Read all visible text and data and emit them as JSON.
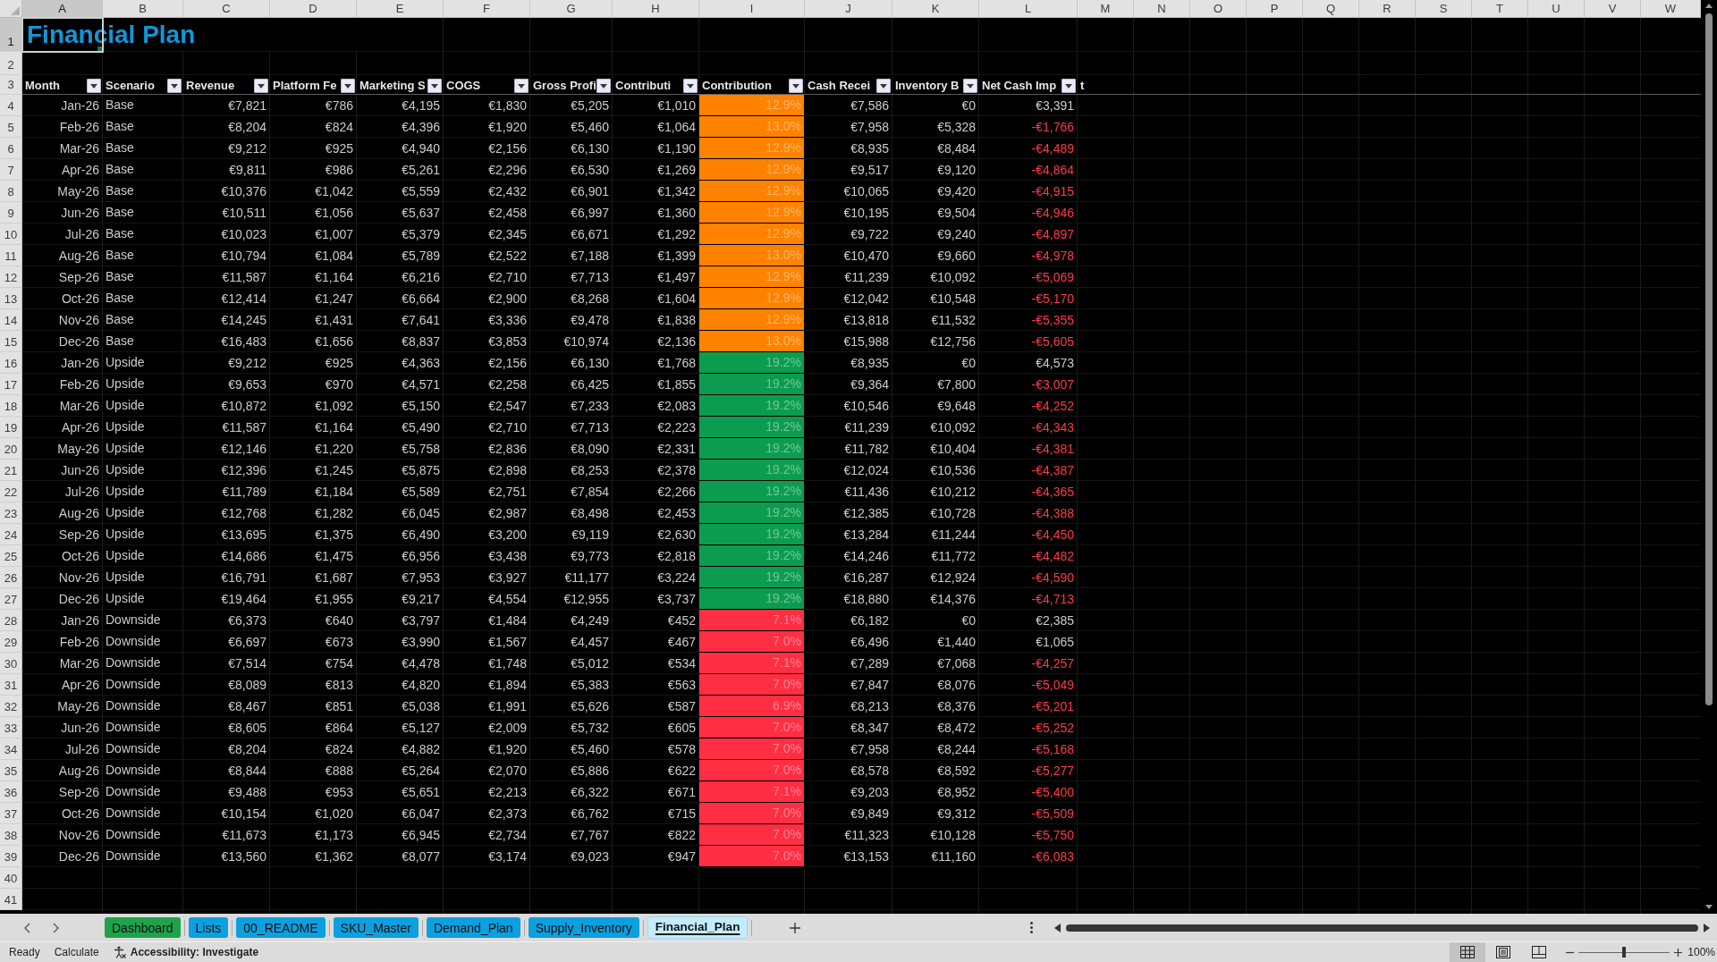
{
  "sheet": {
    "columns": [
      {
        "letter": "A",
        "selected": true
      },
      {
        "letter": "B",
        "selected": false
      },
      {
        "letter": "C",
        "selected": false
      },
      {
        "letter": "D",
        "selected": false
      },
      {
        "letter": "E",
        "selected": false
      },
      {
        "letter": "F",
        "selected": false
      },
      {
        "letter": "G",
        "selected": false
      },
      {
        "letter": "H",
        "selected": false
      },
      {
        "letter": "I",
        "selected": false
      },
      {
        "letter": "J",
        "selected": false
      },
      {
        "letter": "K",
        "selected": false
      },
      {
        "letter": "L",
        "selected": false
      },
      {
        "letter": "M",
        "selected": false
      },
      {
        "letter": "N",
        "selected": false
      },
      {
        "letter": "O",
        "selected": false
      },
      {
        "letter": "P",
        "selected": false
      },
      {
        "letter": "Q",
        "selected": false
      },
      {
        "letter": "R",
        "selected": false
      },
      {
        "letter": "S",
        "selected": false
      },
      {
        "letter": "T",
        "selected": false
      },
      {
        "letter": "U",
        "selected": false
      },
      {
        "letter": "V",
        "selected": false
      },
      {
        "letter": "W",
        "selected": false
      }
    ],
    "rows": [
      {
        "label": "1",
        "selected": true
      },
      {
        "label": "2",
        "selected": false
      },
      {
        "label": "3",
        "selected": false
      },
      {
        "label": "4",
        "selected": false
      },
      {
        "label": "5",
        "selected": false
      },
      {
        "label": "6",
        "selected": false
      },
      {
        "label": "7",
        "selected": false
      },
      {
        "label": "8",
        "selected": false
      },
      {
        "label": "9",
        "selected": false
      },
      {
        "label": "10",
        "selected": false
      },
      {
        "label": "11",
        "selected": false
      },
      {
        "label": "12",
        "selected": false
      },
      {
        "label": "13",
        "selected": false
      },
      {
        "label": "14",
        "selected": false
      },
      {
        "label": "15",
        "selected": false
      },
      {
        "label": "16",
        "selected": false
      },
      {
        "label": "17",
        "selected": false
      },
      {
        "label": "18",
        "selected": false
      },
      {
        "label": "19",
        "selected": false
      },
      {
        "label": "20",
        "selected": false
      },
      {
        "label": "21",
        "selected": false
      },
      {
        "label": "22",
        "selected": false
      },
      {
        "label": "23",
        "selected": false
      },
      {
        "label": "24",
        "selected": false
      },
      {
        "label": "25",
        "selected": false
      },
      {
        "label": "26",
        "selected": false
      },
      {
        "label": "27",
        "selected": false
      },
      {
        "label": "28",
        "selected": false
      },
      {
        "label": "29",
        "selected": false
      },
      {
        "label": "30",
        "selected": false
      },
      {
        "label": "31",
        "selected": false
      },
      {
        "label": "32",
        "selected": false
      },
      {
        "label": "33",
        "selected": false
      },
      {
        "label": "34",
        "selected": false
      },
      {
        "label": "35",
        "selected": false
      },
      {
        "label": "36",
        "selected": false
      },
      {
        "label": "37",
        "selected": false
      },
      {
        "label": "38",
        "selected": false
      },
      {
        "label": "39",
        "selected": false
      },
      {
        "label": "40",
        "selected": false
      },
      {
        "label": "41",
        "selected": false
      }
    ],
    "title": "Financial Plan"
  },
  "table": {
    "columns": [
      {
        "label": "Month",
        "kind": "date"
      },
      {
        "label": "Scenario",
        "kind": "text"
      },
      {
        "label": "Revenue",
        "kind": "currency"
      },
      {
        "label": "Platform Fe",
        "kind": "currency"
      },
      {
        "label": "Marketing S",
        "kind": "currency"
      },
      {
        "label": "COGS",
        "kind": "currency"
      },
      {
        "label": "Gross Profi",
        "kind": "currency"
      },
      {
        "label": "Contributi",
        "kind": "currency"
      },
      {
        "label": "Contribution",
        "kind": "percent"
      },
      {
        "label": "Cash Recei",
        "kind": "currency"
      },
      {
        "label": "Inventory B",
        "kind": "currency"
      },
      {
        "label": "Net Cash Imp",
        "tail": "t",
        "kind": "signed_currency"
      }
    ],
    "rows": [
      {
        "cells": [
          "Jan-26",
          "Base",
          "€7,821",
          "€786",
          "€4,195",
          "€1,830",
          "€5,205",
          "€1,010",
          "12.9%",
          "€7,586",
          "€0",
          "€3,391"
        ],
        "color": "#ff8200",
        "negative": false
      },
      {
        "cells": [
          "Feb-26",
          "Base",
          "€8,204",
          "€824",
          "€4,396",
          "€1,920",
          "€5,460",
          "€1,064",
          "13.0%",
          "€7,958",
          "€5,328",
          "-€1,766"
        ],
        "color": "#ff8200",
        "negative": true
      },
      {
        "cells": [
          "Mar-26",
          "Base",
          "€9,212",
          "€925",
          "€4,940",
          "€2,156",
          "€6,130",
          "€1,190",
          "12.9%",
          "€8,935",
          "€8,484",
          "-€4,489"
        ],
        "color": "#ff8200",
        "negative": true
      },
      {
        "cells": [
          "Apr-26",
          "Base",
          "€9,811",
          "€986",
          "€5,261",
          "€2,296",
          "€6,530",
          "€1,269",
          "12.9%",
          "€9,517",
          "€9,120",
          "-€4,864"
        ],
        "color": "#ff8200",
        "negative": true
      },
      {
        "cells": [
          "May-26",
          "Base",
          "€10,376",
          "€1,042",
          "€5,559",
          "€2,432",
          "€6,901",
          "€1,342",
          "12.9%",
          "€10,065",
          "€9,420",
          "-€4,915"
        ],
        "color": "#ff8200",
        "negative": true
      },
      {
        "cells": [
          "Jun-26",
          "Base",
          "€10,511",
          "€1,056",
          "€5,637",
          "€2,458",
          "€6,997",
          "€1,360",
          "12.9%",
          "€10,195",
          "€9,504",
          "-€4,946"
        ],
        "color": "#ff8200",
        "negative": true
      },
      {
        "cells": [
          "Jul-26",
          "Base",
          "€10,023",
          "€1,007",
          "€5,379",
          "€2,345",
          "€6,671",
          "€1,292",
          "12.9%",
          "€9,722",
          "€9,240",
          "-€4,897"
        ],
        "color": "#ff8200",
        "negative": true
      },
      {
        "cells": [
          "Aug-26",
          "Base",
          "€10,794",
          "€1,084",
          "€5,789",
          "€2,522",
          "€7,188",
          "€1,399",
          "13.0%",
          "€10,470",
          "€9,660",
          "-€4,978"
        ],
        "color": "#ff8200",
        "negative": true
      },
      {
        "cells": [
          "Sep-26",
          "Base",
          "€11,587",
          "€1,164",
          "€6,216",
          "€2,710",
          "€7,713",
          "€1,497",
          "12.9%",
          "€11,239",
          "€10,092",
          "-€5,069"
        ],
        "color": "#ff8200",
        "negative": true
      },
      {
        "cells": [
          "Oct-26",
          "Base",
          "€12,414",
          "€1,247",
          "€6,664",
          "€2,900",
          "€8,268",
          "€1,604",
          "12.9%",
          "€12,042",
          "€10,548",
          "-€5,170"
        ],
        "color": "#ff8200",
        "negative": true
      },
      {
        "cells": [
          "Nov-26",
          "Base",
          "€14,245",
          "€1,431",
          "€7,641",
          "€3,336",
          "€9,478",
          "€1,838",
          "12.9%",
          "€13,818",
          "€11,532",
          "-€5,355"
        ],
        "color": "#ff8200",
        "negative": true
      },
      {
        "cells": [
          "Dec-26",
          "Base",
          "€16,483",
          "€1,656",
          "€8,837",
          "€3,853",
          "€10,974",
          "€2,136",
          "13.0%",
          "€15,988",
          "€12,756",
          "-€5,605"
        ],
        "color": "#ff8200",
        "negative": true
      },
      {
        "cells": [
          "Jan-26",
          "Upside",
          "€9,212",
          "€925",
          "€4,363",
          "€2,156",
          "€6,130",
          "€1,768",
          "19.2%",
          "€8,935",
          "€0",
          "€4,573"
        ],
        "color": "#0c9c50",
        "negative": false
      },
      {
        "cells": [
          "Feb-26",
          "Upside",
          "€9,653",
          "€970",
          "€4,571",
          "€2,258",
          "€6,425",
          "€1,855",
          "19.2%",
          "€9,364",
          "€7,800",
          "-€3,007"
        ],
        "color": "#0c9c50",
        "negative": true
      },
      {
        "cells": [
          "Mar-26",
          "Upside",
          "€10,872",
          "€1,092",
          "€5,150",
          "€2,547",
          "€7,233",
          "€2,083",
          "19.2%",
          "€10,546",
          "€9,648",
          "-€4,252"
        ],
        "color": "#0c9c50",
        "negative": true
      },
      {
        "cells": [
          "Apr-26",
          "Upside",
          "€11,587",
          "€1,164",
          "€5,490",
          "€2,710",
          "€7,713",
          "€2,223",
          "19.2%",
          "€11,239",
          "€10,092",
          "-€4,343"
        ],
        "color": "#0c9c50",
        "negative": true
      },
      {
        "cells": [
          "May-26",
          "Upside",
          "€12,146",
          "€1,220",
          "€5,758",
          "€2,836",
          "€8,090",
          "€2,331",
          "19.2%",
          "€11,782",
          "€10,404",
          "-€4,381"
        ],
        "color": "#0c9c50",
        "negative": true
      },
      {
        "cells": [
          "Jun-26",
          "Upside",
          "€12,396",
          "€1,245",
          "€5,875",
          "€2,898",
          "€8,253",
          "€2,378",
          "19.2%",
          "€12,024",
          "€10,536",
          "-€4,387"
        ],
        "color": "#0c9c50",
        "negative": true
      },
      {
        "cells": [
          "Jul-26",
          "Upside",
          "€11,789",
          "€1,184",
          "€5,589",
          "€2,751",
          "€7,854",
          "€2,266",
          "19.2%",
          "€11,436",
          "€10,212",
          "-€4,365"
        ],
        "color": "#0c9c50",
        "negative": true
      },
      {
        "cells": [
          "Aug-26",
          "Upside",
          "€12,768",
          "€1,282",
          "€6,045",
          "€2,987",
          "€8,498",
          "€2,453",
          "19.2%",
          "€12,385",
          "€10,728",
          "-€4,388"
        ],
        "color": "#0c9c50",
        "negative": true
      },
      {
        "cells": [
          "Sep-26",
          "Upside",
          "€13,695",
          "€1,375",
          "€6,490",
          "€3,200",
          "€9,119",
          "€2,630",
          "19.2%",
          "€13,284",
          "€11,244",
          "-€4,450"
        ],
        "color": "#0c9c50",
        "negative": true
      },
      {
        "cells": [
          "Oct-26",
          "Upside",
          "€14,686",
          "€1,475",
          "€6,956",
          "€3,438",
          "€9,773",
          "€2,818",
          "19.2%",
          "€14,246",
          "€11,772",
          "-€4,482"
        ],
        "color": "#0c9c50",
        "negative": true
      },
      {
        "cells": [
          "Nov-26",
          "Upside",
          "€16,791",
          "€1,687",
          "€7,953",
          "€3,927",
          "€11,177",
          "€3,224",
          "19.2%",
          "€16,287",
          "€12,924",
          "-€4,590"
        ],
        "color": "#0c9c50",
        "negative": true
      },
      {
        "cells": [
          "Dec-26",
          "Upside",
          "€19,464",
          "€1,955",
          "€9,217",
          "€4,554",
          "€12,955",
          "€3,737",
          "19.2%",
          "€18,880",
          "€14,376",
          "-€4,713"
        ],
        "color": "#0c9c50",
        "negative": true
      },
      {
        "cells": [
          "Jan-26",
          "Downside",
          "€6,373",
          "€640",
          "€3,797",
          "€1,484",
          "€4,249",
          "€452",
          "7.1%",
          "€6,182",
          "€0",
          "€2,385"
        ],
        "color": "#ff2e43",
        "negative": false
      },
      {
        "cells": [
          "Feb-26",
          "Downside",
          "€6,697",
          "€673",
          "€3,990",
          "€1,567",
          "€4,457",
          "€467",
          "7.0%",
          "€6,496",
          "€1,440",
          "€1,065"
        ],
        "color": "#ff2e43",
        "negative": false
      },
      {
        "cells": [
          "Mar-26",
          "Downside",
          "€7,514",
          "€754",
          "€4,478",
          "€1,748",
          "€5,012",
          "€534",
          "7.1%",
          "€7,289",
          "€7,068",
          "-€4,257"
        ],
        "color": "#ff2e43",
        "negative": true
      },
      {
        "cells": [
          "Apr-26",
          "Downside",
          "€8,089",
          "€813",
          "€4,820",
          "€1,894",
          "€5,383",
          "€563",
          "7.0%",
          "€7,847",
          "€8,076",
          "-€5,049"
        ],
        "color": "#ff2e43",
        "negative": true
      },
      {
        "cells": [
          "May-26",
          "Downside",
          "€8,467",
          "€851",
          "€5,038",
          "€1,991",
          "€5,626",
          "€587",
          "6.9%",
          "€8,213",
          "€8,376",
          "-€5,201"
        ],
        "color": "#ff2e43",
        "negative": true
      },
      {
        "cells": [
          "Jun-26",
          "Downside",
          "€8,605",
          "€864",
          "€5,127",
          "€2,009",
          "€5,732",
          "€605",
          "7.0%",
          "€8,347",
          "€8,472",
          "-€5,252"
        ],
        "color": "#ff2e43",
        "negative": true
      },
      {
        "cells": [
          "Jul-26",
          "Downside",
          "€8,204",
          "€824",
          "€4,882",
          "€1,920",
          "€5,460",
          "€578",
          "7.0%",
          "€7,958",
          "€8,244",
          "-€5,168"
        ],
        "color": "#ff2e43",
        "negative": true
      },
      {
        "cells": [
          "Aug-26",
          "Downside",
          "€8,844",
          "€888",
          "€5,264",
          "€2,070",
          "€5,886",
          "€622",
          "7.0%",
          "€8,578",
          "€8,592",
          "-€5,277"
        ],
        "color": "#ff2e43",
        "negative": true
      },
      {
        "cells": [
          "Sep-26",
          "Downside",
          "€9,488",
          "€953",
          "€5,651",
          "€2,213",
          "€6,322",
          "€671",
          "7.1%",
          "€9,203",
          "€8,952",
          "-€5,400"
        ],
        "color": "#ff2e43",
        "negative": true
      },
      {
        "cells": [
          "Oct-26",
          "Downside",
          "€10,154",
          "€1,020",
          "€6,047",
          "€2,373",
          "€6,762",
          "€715",
          "7.0%",
          "€9,849",
          "€9,312",
          "-€5,509"
        ],
        "color": "#ff2e43",
        "negative": true
      },
      {
        "cells": [
          "Nov-26",
          "Downside",
          "€11,673",
          "€1,173",
          "€6,945",
          "€2,734",
          "€7,767",
          "€822",
          "7.0%",
          "€11,323",
          "€10,128",
          "-€5,750"
        ],
        "color": "#ff2e43",
        "negative": true
      },
      {
        "cells": [
          "Dec-26",
          "Downside",
          "€13,560",
          "€1,362",
          "€8,077",
          "€3,174",
          "€9,023",
          "€947",
          "7.0%",
          "€13,153",
          "€11,160",
          "-€6,083"
        ],
        "color": "#ff2e43",
        "negative": true
      }
    ]
  },
  "sheet_tabs": [
    {
      "label": "Dashboard",
      "color": "#1fa24c",
      "selected": false
    },
    {
      "label": "Lists",
      "color": "#0ca0e0",
      "selected": false
    },
    {
      "label": "00_README",
      "color": "#0ca0e0",
      "selected": false
    },
    {
      "label": "SKU_Master",
      "color": "#0ca0e0",
      "selected": false
    },
    {
      "label": "Demand_Plan",
      "color": "#0ca0e0",
      "selected": false
    },
    {
      "label": "Supply_Inventory",
      "color": "#0ca0e0",
      "selected": false
    },
    {
      "label": "Financial_Plan",
      "color": "#c4ecfa",
      "selected": true
    }
  ],
  "status_bar": {
    "items": [
      {
        "kind": "text",
        "label": "Ready"
      },
      {
        "kind": "command",
        "label": "Calculate"
      },
      {
        "kind": "accessibility",
        "label": "Accessibility: Investigate"
      }
    ],
    "views": [
      {
        "kind": "normal",
        "selected": true
      },
      {
        "kind": "page_layout",
        "selected": false
      },
      {
        "kind": "page_break",
        "selected": false
      }
    ],
    "zoom": {
      "level": 0.5,
      "reading": "100%"
    }
  }
}
